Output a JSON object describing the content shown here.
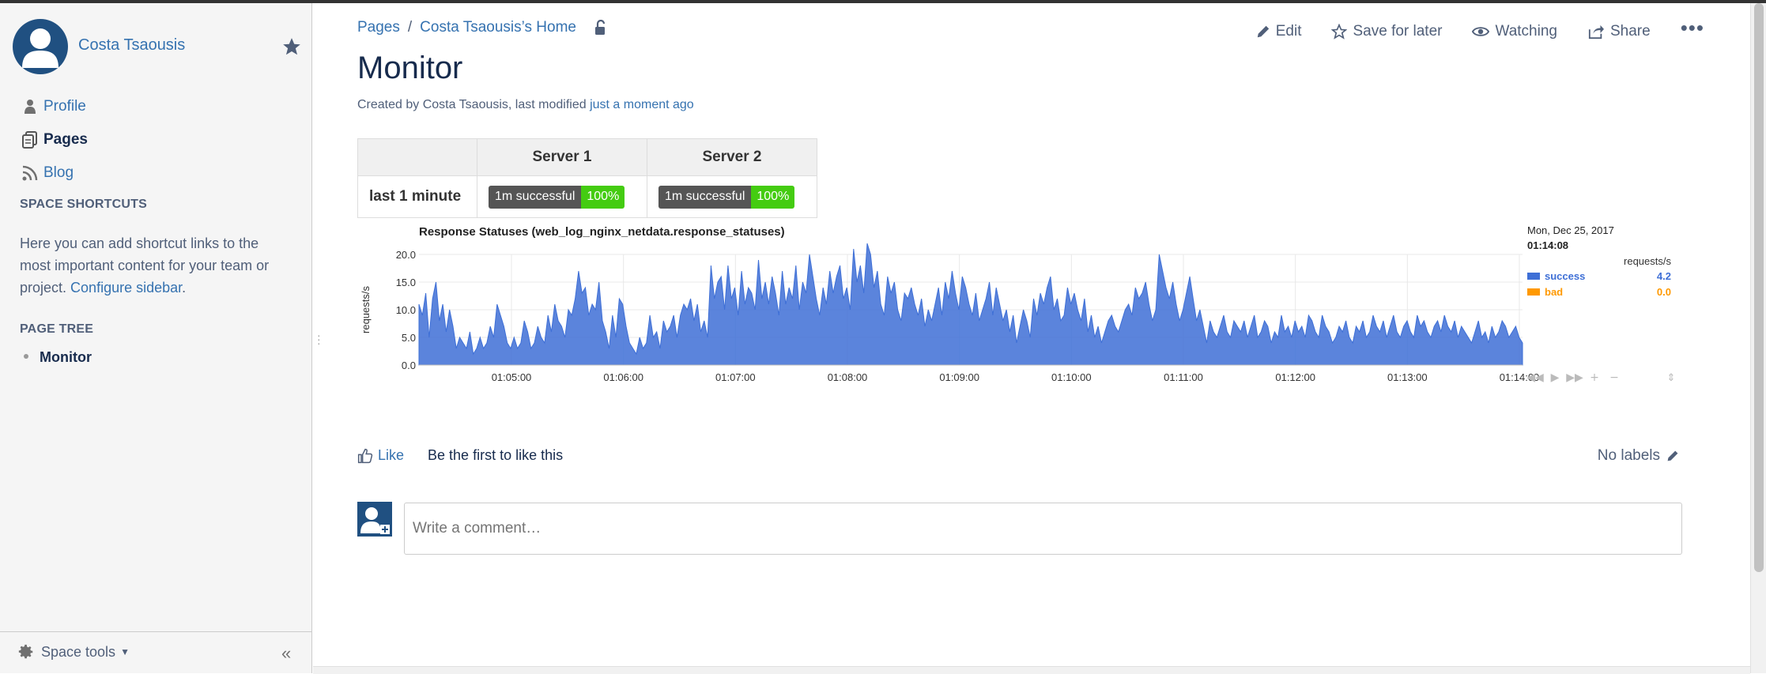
{
  "sidebar": {
    "user_name": "Costa Tsaousis",
    "nav": [
      {
        "label": "Profile",
        "icon": "person-icon"
      },
      {
        "label": "Pages",
        "icon": "pages-icon"
      },
      {
        "label": "Blog",
        "icon": "rss-icon"
      }
    ],
    "shortcuts_heading": "SPACE SHORTCUTS",
    "shortcuts_text": "Here you can add shortcut links to the most important content for your team or project.",
    "configure_link": "Configure sidebar",
    "shortcuts_period": ".",
    "tree_heading": "PAGE TREE",
    "tree_item": "Monitor",
    "space_tools": "Space tools"
  },
  "breadcrumb": {
    "root": "Pages",
    "sep": "/",
    "home": "Costa Tsaousis’s Home"
  },
  "actions": {
    "edit": "Edit",
    "save": "Save for later",
    "watching": "Watching",
    "share": "Share",
    "more": "•••"
  },
  "page": {
    "title": "Monitor",
    "meta_prefix": "Created by Costa Tsaousis, last modified ",
    "meta_link": "just a moment ago"
  },
  "status_table": {
    "headers": [
      "",
      "Server 1",
      "Server 2"
    ],
    "row_label": "last 1 minute",
    "cells": [
      {
        "label": "1m successful",
        "value": "100%"
      },
      {
        "label": "1m successful",
        "value": "100%"
      }
    ]
  },
  "chart_data": {
    "type": "area",
    "title": "Response Statuses (web_log_nginx_netdata.response_statuses)",
    "ylabel": "requests/s",
    "ylim": [
      0,
      20
    ],
    "yticks": [
      "0.0",
      "5.0",
      "10.0",
      "15.0",
      "20.0"
    ],
    "xticks": [
      "01:05:00",
      "01:06:00",
      "01:07:00",
      "01:08:00",
      "01:09:00",
      "01:10:00",
      "01:11:00",
      "01:12:00",
      "01:13:00",
      "01:14:00"
    ],
    "legend_date": "Mon, Dec 25, 2017",
    "legend_time": "01:14:08",
    "legend_units": "requests/s",
    "colors": {
      "success": "#3e6fd6",
      "bad": "#ff9900"
    },
    "series": [
      {
        "name": "success",
        "latest": "4.2",
        "values": [
          11,
          9,
          13,
          5,
          12,
          15,
          8,
          11,
          6,
          10,
          7,
          3,
          5,
          4,
          3,
          6,
          2,
          3,
          5,
          3,
          4,
          7,
          5,
          11,
          9,
          7,
          4,
          3,
          5,
          3,
          4,
          8,
          6,
          3,
          4,
          7,
          5,
          4,
          9,
          6,
          11,
          8,
          7,
          5,
          10,
          9,
          12,
          17,
          13,
          14,
          9,
          11,
          10,
          15,
          8,
          6,
          3,
          9,
          5,
          12,
          11,
          7,
          4,
          3,
          2,
          5,
          3,
          4,
          9,
          5,
          6,
          3,
          8,
          6,
          7,
          9,
          5,
          9,
          11,
          10,
          12,
          8,
          11,
          6,
          8,
          5,
          18,
          12,
          15,
          16,
          10,
          18,
          12,
          14,
          9,
          17,
          11,
          14,
          13,
          10,
          19,
          12,
          15,
          11,
          16,
          13,
          9,
          17,
          11,
          14,
          12,
          18,
          10,
          15,
          13,
          20,
          16,
          12,
          9,
          14,
          11,
          17,
          13,
          16,
          18,
          12,
          14,
          10,
          21,
          15,
          18,
          13,
          22,
          20,
          14,
          17,
          11,
          9,
          16,
          13,
          15,
          10,
          8,
          13,
          12,
          14,
          11,
          9,
          12,
          7,
          10,
          8,
          11,
          14,
          9,
          15,
          12,
          17,
          13,
          10,
          16,
          14,
          11,
          9,
          13,
          8,
          10,
          12,
          15,
          9,
          14,
          11,
          8,
          10,
          6,
          9,
          4,
          7,
          10,
          8,
          5,
          12,
          9,
          13,
          11,
          14,
          16,
          10,
          12,
          8,
          9,
          14,
          11,
          13,
          10,
          8,
          12,
          6,
          9,
          5,
          7,
          4,
          6,
          8,
          9,
          7,
          6,
          8,
          10,
          11,
          9,
          14,
          12,
          13,
          15,
          11,
          8,
          10,
          20,
          17,
          14,
          12,
          15,
          11,
          8,
          10,
          13,
          16,
          12,
          8,
          10,
          7,
          4,
          8,
          6,
          5,
          7,
          9,
          6,
          5,
          8,
          7,
          6,
          8,
          5,
          7,
          9,
          5,
          6,
          8,
          7,
          4,
          6,
          5,
          9,
          6,
          7,
          5,
          8,
          6,
          7,
          5,
          9,
          8,
          6,
          5,
          9,
          7,
          6,
          4,
          5,
          7,
          6,
          8,
          5,
          4,
          7,
          6,
          8,
          5,
          6,
          9,
          7,
          6,
          8,
          5,
          7,
          9,
          6,
          5,
          7,
          8,
          6,
          5,
          9,
          7,
          8,
          6,
          5,
          7,
          8,
          6,
          9,
          7,
          6,
          8,
          5,
          7,
          6,
          5,
          4,
          6,
          8,
          5,
          6,
          4,
          7,
          5,
          6,
          8,
          7,
          5,
          6,
          7,
          5,
          4
        ]
      },
      {
        "name": "bad",
        "latest": "0.0",
        "values": []
      }
    ],
    "legend": "right"
  },
  "like": {
    "label": "Like",
    "text": "Be the first to like this"
  },
  "labels": {
    "text": "No labels"
  },
  "comment": {
    "placeholder": "Write a comment…"
  }
}
